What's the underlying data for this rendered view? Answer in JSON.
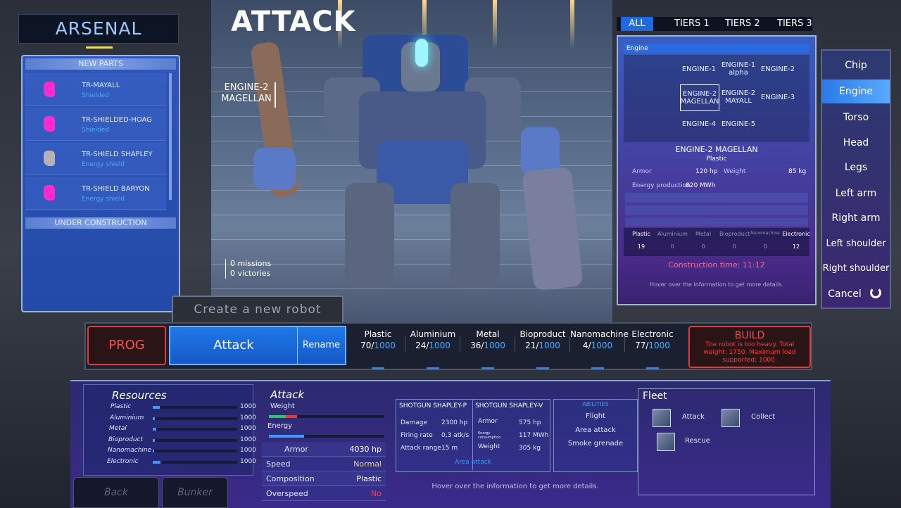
{
  "arsenal": {
    "title": "ARSENAL",
    "new_parts_label": "NEW PARTS",
    "under_construction_label": "UNDER CONSTRUCTION",
    "parts": [
      {
        "name": "TR-MAYALL",
        "type": "Shielded",
        "icon": "magenta-part-icon",
        "color": "#ff2ad0"
      },
      {
        "name": "TR-SHIELDED-HOAG",
        "type": "Shielded",
        "icon": "magenta-part-icon",
        "color": "#ff2ad0"
      },
      {
        "name": "TR-SHIELD SHAPLEY",
        "type": "Energy shield",
        "icon": "metal-part-icon",
        "color": "#b8b0b8"
      },
      {
        "name": "TR-SHIELD BARYON",
        "type": "Energy shield",
        "icon": "magenta-part-icon",
        "color": "#ff2ad0"
      }
    ]
  },
  "viewport": {
    "title": "ATTACK",
    "selected_part": "ENGINE-2\nMAGELLAN",
    "missions": "0 missions",
    "victories": "0 victories"
  },
  "tiers": [
    "ALL",
    "TIERS 1",
    "TIERS 2",
    "TIERS 3"
  ],
  "engine_panel": {
    "header": "Engine",
    "grid": [
      "ENGINE-1",
      "ENGINE-1\nalpha",
      "ENGINE-2",
      "ENGINE-2\nMAGELLAN",
      "ENGINE-2\nMAYALL",
      "ENGINE-3",
      "ENGINE-4",
      "ENGINE-5"
    ],
    "detail_name": "ENGINE-2 MAGELLAN",
    "detail_material": "Plastic",
    "armor_label": "Armor",
    "armor_value": "120 hp",
    "weight_label": "Weight",
    "weight_value": "85 kg",
    "energy_label": "Energy production",
    "energy_value": "820 MWh",
    "materials": [
      {
        "name": "Plastic",
        "value": "19"
      },
      {
        "name": "Aluminium",
        "value": "0"
      },
      {
        "name": "Metal",
        "value": "0"
      },
      {
        "name": "Bioproduct",
        "value": "0"
      },
      {
        "name": "Nanomachine",
        "value": "0"
      },
      {
        "name": "Electronic",
        "value": "12"
      }
    ],
    "construction_time": "Construction time: 11:12",
    "hover_hint": "Hover over the information to get more details."
  },
  "categories": [
    "Chip",
    "Engine",
    "Torso",
    "Head",
    "Legs",
    "Left arm",
    "Right arm",
    "Left shoulder",
    "Right shoulder",
    "Cancel"
  ],
  "selected_category": "Engine",
  "toolbar": {
    "create_label": "Create a new robot",
    "prog_label": "PROG",
    "robot_name": "Attack",
    "rename_label": "Rename",
    "build_label": "BUILD",
    "build_warning": "The robot is too heavy. Total weight: 1750. Maximum load supported: 1000."
  },
  "top_resources": [
    {
      "name": "Plastic",
      "value": "70",
      "max": "1000"
    },
    {
      "name": "Aluminium",
      "value": "24",
      "max": "1000"
    },
    {
      "name": "Metal",
      "value": "36",
      "max": "1000"
    },
    {
      "name": "Bioproduct",
      "value": "21",
      "max": "1000"
    },
    {
      "name": "Nanomachine",
      "value": "4",
      "max": "1000"
    },
    {
      "name": "Electronic",
      "value": "77",
      "max": "1000"
    }
  ],
  "resources": {
    "title": "Resources",
    "items": [
      {
        "name": "Plastic",
        "max": "1000",
        "fill": 0.07
      },
      {
        "name": "Aluminium",
        "max": "1000",
        "fill": 0.024
      },
      {
        "name": "Metal",
        "max": "1000",
        "fill": 0.036
      },
      {
        "name": "Bioproduct",
        "max": "1000",
        "fill": 0.021
      },
      {
        "name": "Nanomachine",
        "max": "1000",
        "fill": 0.004
      },
      {
        "name": "Electronic",
        "max": "1000",
        "fill": 0.077
      }
    ]
  },
  "robot_stats": {
    "title": "Attack",
    "weight_label": "Weight",
    "energy_label": "Energy",
    "rows": [
      {
        "label": "Armor",
        "value": "4030  hp"
      },
      {
        "label": "Speed",
        "value": "Normal"
      },
      {
        "label": "Composition",
        "value": "Plastic"
      },
      {
        "label": "Overspeed",
        "value": "No"
      }
    ]
  },
  "weapons": {
    "tabs": [
      "SHOTGUN SHAPLEY-P",
      "SHOTGUN SHAPLEY-V"
    ],
    "left": [
      {
        "label": "Damage",
        "value": "2300 hp"
      },
      {
        "label": "Firing rate",
        "value": "0,3  atk/s"
      },
      {
        "label": "Attack range",
        "value": "15  m"
      }
    ],
    "right": [
      {
        "label": "Armor",
        "value": "575 hp"
      },
      {
        "label": "Energy consumption",
        "value": "117 MWh"
      },
      {
        "label": "Weight",
        "value": "305 kg"
      }
    ],
    "area_attack": "Area attack"
  },
  "abilities": {
    "title": "ABILITIES",
    "items": [
      "Flight",
      "Area attack",
      "Smoke grenade"
    ]
  },
  "fleet": {
    "title": "Fleet",
    "items": [
      "Attack",
      "Collect",
      "Rescue"
    ]
  },
  "bottom_hint": "Hover over the information to get more details.",
  "nav": {
    "back": "Back",
    "bunker": "Bunker"
  },
  "colors": {
    "accent": "#1e78e8",
    "warning": "#e03a3a",
    "highlight": "#4fa8ff"
  }
}
